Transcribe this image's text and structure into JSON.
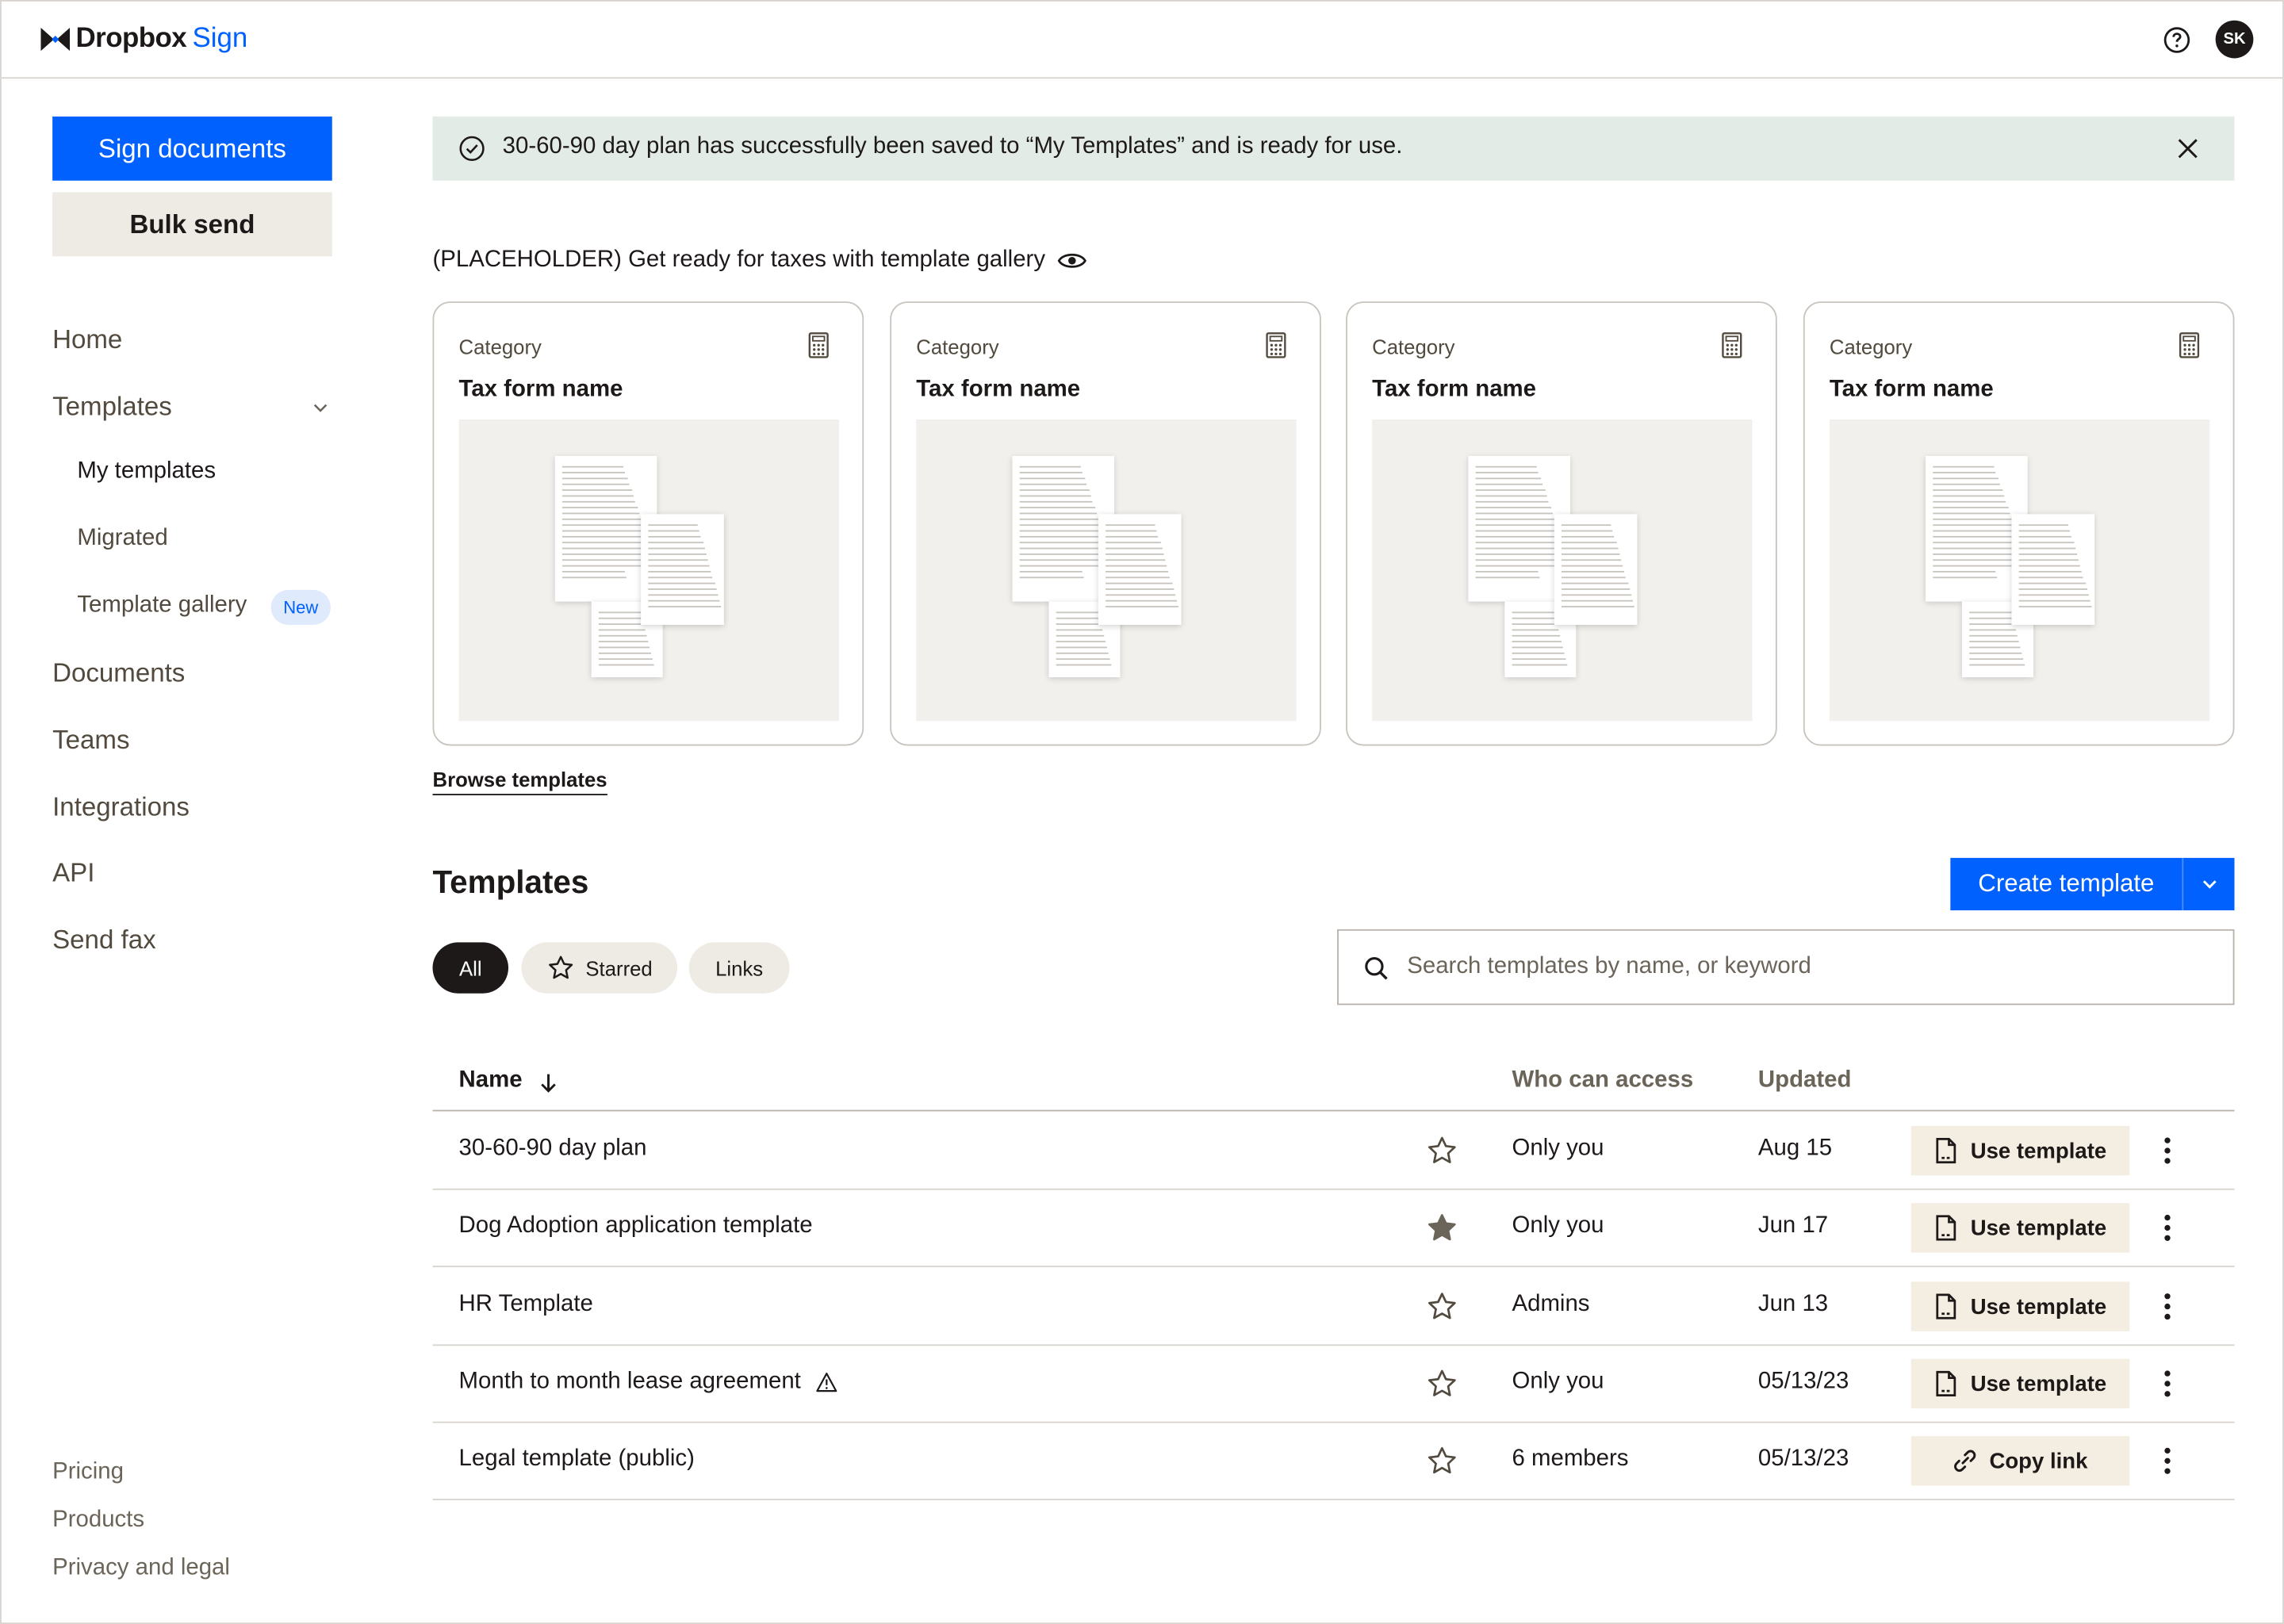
{
  "brand": {
    "wordmark": "Dropbox",
    "product": "Sign",
    "logo_icon": "dropbox-icon"
  },
  "header": {
    "help_icon": "help-icon",
    "avatar_initials": "SK"
  },
  "sidebar": {
    "primary_button": "Sign documents",
    "secondary_button": "Bulk send",
    "nav": {
      "home": "Home",
      "templates": "Templates",
      "my_templates": "My templates",
      "migrated": "Migrated",
      "template_gallery": "Template gallery",
      "new_badge": "New",
      "documents": "Documents",
      "teams": "Teams",
      "integrations": "Integrations",
      "api": "API",
      "send_fax": "Send fax"
    },
    "footer": {
      "pricing": "Pricing",
      "products": "Products",
      "privacy": "Privacy and legal"
    }
  },
  "banner": {
    "message": "30-60-90 day plan has successfully been saved to “My Templates” and is ready for use."
  },
  "gallery": {
    "heading": "(PLACEHOLDER) Get ready for taxes with template gallery",
    "cards": [
      {
        "category": "Category",
        "name": "Tax form name"
      },
      {
        "category": "Category",
        "name": "Tax form name"
      },
      {
        "category": "Category",
        "name": "Tax form name"
      },
      {
        "category": "Category",
        "name": "Tax form name"
      }
    ],
    "browse_link": "Browse templates"
  },
  "templates": {
    "title": "Templates",
    "create_button": "Create template",
    "filters": {
      "all": "All",
      "starred": "Starred",
      "links": "Links"
    },
    "search": {
      "placeholder": "Search templates by name, or keyword",
      "value": ""
    },
    "columns": {
      "name": "Name",
      "access": "Who can access",
      "updated": "Updated"
    },
    "rows": [
      {
        "name": "30-60-90 day plan",
        "starred": false,
        "warning": false,
        "access": "Only you",
        "updated": "Aug 15",
        "action": "Use template",
        "action_icon": "document-icon"
      },
      {
        "name": "Dog Adoption application template",
        "starred": true,
        "warning": false,
        "access": "Only you",
        "updated": "Jun 17",
        "action": "Use template",
        "action_icon": "document-icon"
      },
      {
        "name": "HR Template",
        "starred": false,
        "warning": false,
        "access": "Admins",
        "updated": "Jun 13",
        "action": "Use template",
        "action_icon": "document-icon"
      },
      {
        "name": "Month to month lease agreement",
        "starred": false,
        "warning": true,
        "access": "Only you",
        "updated": "05/13/23",
        "action": "Use template",
        "action_icon": "document-icon"
      },
      {
        "name": "Legal template (public)",
        "starred": false,
        "warning": false,
        "access": "6 members",
        "updated": "05/13/23",
        "action": "Copy link",
        "action_icon": "link-icon"
      }
    ]
  },
  "colors": {
    "primary": "#0061fe",
    "text": "#1e1919",
    "banner_bg": "#e3ebe7",
    "chip_bg": "#eeeae4",
    "action_bg": "#f4ede2",
    "star_filled": "#6b6459"
  }
}
